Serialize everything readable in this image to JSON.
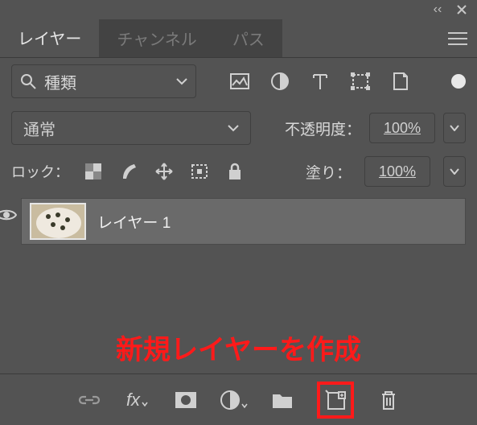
{
  "titlebar": {
    "collapse": "‹‹",
    "close": "×"
  },
  "tabs": {
    "layers": "レイヤー",
    "channels": "チャンネル",
    "paths": "パス"
  },
  "filter": {
    "label": "種類"
  },
  "blend": {
    "mode": "通常",
    "opacity_label": "不透明度：",
    "opacity_value": "100%"
  },
  "lock": {
    "label": "ロック：",
    "fill_label": "塗り：",
    "fill_value": "100%"
  },
  "layer": {
    "name": "レイヤー 1"
  },
  "caption": "新規レイヤーを作成"
}
